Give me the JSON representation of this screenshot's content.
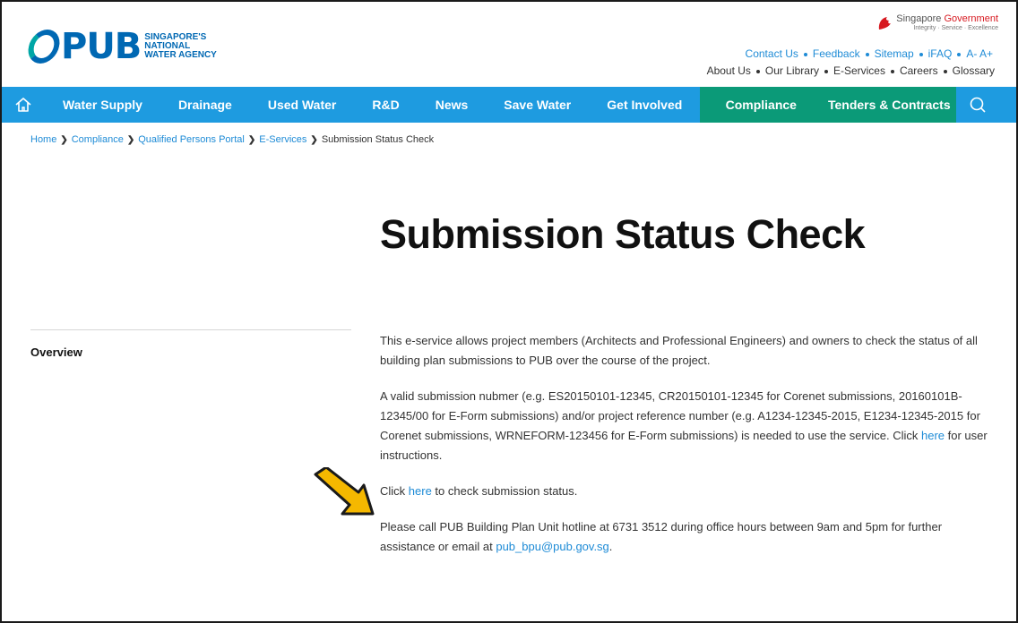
{
  "header": {
    "logo": {
      "word": "PUB",
      "sub_lines": [
        "SINGAPORE'S",
        "NATIONAL",
        "WATER AGENCY"
      ]
    },
    "sg_gov": {
      "title_part1": "Singapore ",
      "title_part2": "Government",
      "motto": "Integrity · Service · Excellence"
    },
    "top_links": [
      "Contact Us",
      "Feedback",
      "Sitemap",
      "iFAQ",
      "A- A+"
    ],
    "main_links": [
      "About Us",
      "Our Library",
      "E-Services",
      "Careers",
      "Glossary"
    ]
  },
  "nav": {
    "items": [
      "Water Supply",
      "Drainage",
      "Used Water",
      "R&D",
      "News",
      "Save Water",
      "Get Involved"
    ],
    "compliance": "Compliance",
    "tenders": "Tenders & Contracts"
  },
  "breadcrumb": {
    "items": [
      "Home",
      "Compliance",
      "Qualified Persons Portal",
      "E-Services"
    ],
    "current": "Submission Status Check"
  },
  "page": {
    "title": "Submission Status Check",
    "sidebar_label": "Overview",
    "para1": "This e-service allows project members (Architects and Professional Engineers) and owners to check the status of all building plan submissions to PUB over the course of the project.",
    "para2_text": "A valid submission nubmer (e.g. ES20150101-12345, CR20150101-12345 for Corenet submissions, 20160101B-12345/00 for E-Form submissions) and/or project reference number (e.g. A1234-12345-2015, E1234-12345-2015 for Corenet submissions, WRNEFORM-123456 for E-Form submissions) is needed to use the service. Click ",
    "para2_link": "here",
    "para2_after": " for user instructions.",
    "para3_before": "Click ",
    "para3_link": "here",
    "para3_after": " to check submission status.",
    "para4_text": "Please call PUB Building Plan Unit hotline at 6731 3512 during office hours between 9am and 5pm for further assistance or email at ",
    "para4_link": "pub_bpu@pub.gov.sg",
    "para4_after": "."
  },
  "colors": {
    "nav_blue": "#1e9be0",
    "nav_green": "#0b9a78",
    "link": "#1e8bd6",
    "arrow_fill": "#f5b800"
  }
}
